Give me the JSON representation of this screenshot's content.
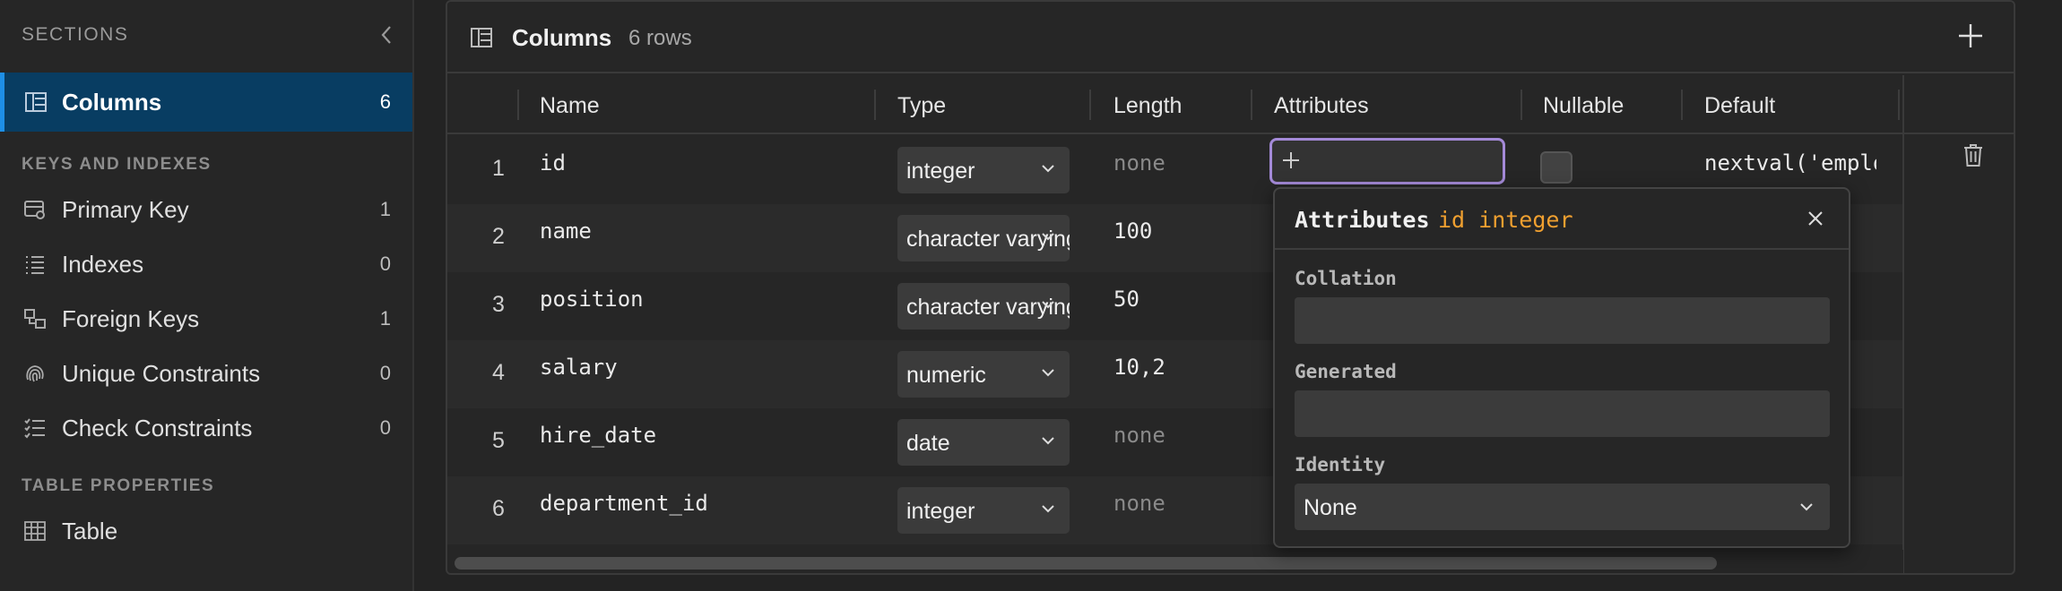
{
  "sidebar": {
    "sections_label": "SECTIONS",
    "keys_label": "KEYS AND INDEXES",
    "props_label": "TABLE PROPERTIES",
    "items": [
      {
        "label": "Columns",
        "count": "6",
        "icon": "columns-icon"
      },
      {
        "label": "Primary Key",
        "count": "1",
        "icon": "key-icon"
      },
      {
        "label": "Indexes",
        "count": "0",
        "icon": "list-icon"
      },
      {
        "label": "Foreign Keys",
        "count": "1",
        "icon": "link-icon"
      },
      {
        "label": "Unique Constraints",
        "count": "0",
        "icon": "fingerprint-icon"
      },
      {
        "label": "Check Constraints",
        "count": "0",
        "icon": "checklist-icon"
      },
      {
        "label": "Table",
        "count": "",
        "icon": "table-icon"
      }
    ]
  },
  "panel": {
    "title": "Columns",
    "rows_label": "6 rows",
    "headers": {
      "name": "Name",
      "type": "Type",
      "length": "Length",
      "attributes": "Attributes",
      "nullable": "Nullable",
      "default": "Default"
    },
    "rows": [
      {
        "num": "1",
        "name": "id",
        "type": "integer",
        "length": "none",
        "default": "nextval('employees_id_seq'::regclass)"
      },
      {
        "num": "2",
        "name": "name",
        "type": "character varying",
        "length": "100",
        "default": ""
      },
      {
        "num": "3",
        "name": "position",
        "type": "character varying",
        "length": "50",
        "default": ""
      },
      {
        "num": "4",
        "name": "salary",
        "type": "numeric",
        "length": "10,2",
        "default": ""
      },
      {
        "num": "5",
        "name": "hire_date",
        "type": "date",
        "length": "none",
        "default": ""
      },
      {
        "num": "6",
        "name": "department_id",
        "type": "integer",
        "length": "none",
        "default": ""
      }
    ]
  },
  "popover": {
    "title": "Attributes",
    "subtitle": "id integer",
    "collation_label": "Collation",
    "collation_value": "",
    "generated_label": "Generated",
    "generated_value": "",
    "identity_label": "Identity",
    "identity_value": "None"
  },
  "colors": {
    "accent": "#1e8fe6",
    "active_bg": "#083d62",
    "focus_ring": "#a48ad8",
    "type_highlight": "#f0a030"
  }
}
